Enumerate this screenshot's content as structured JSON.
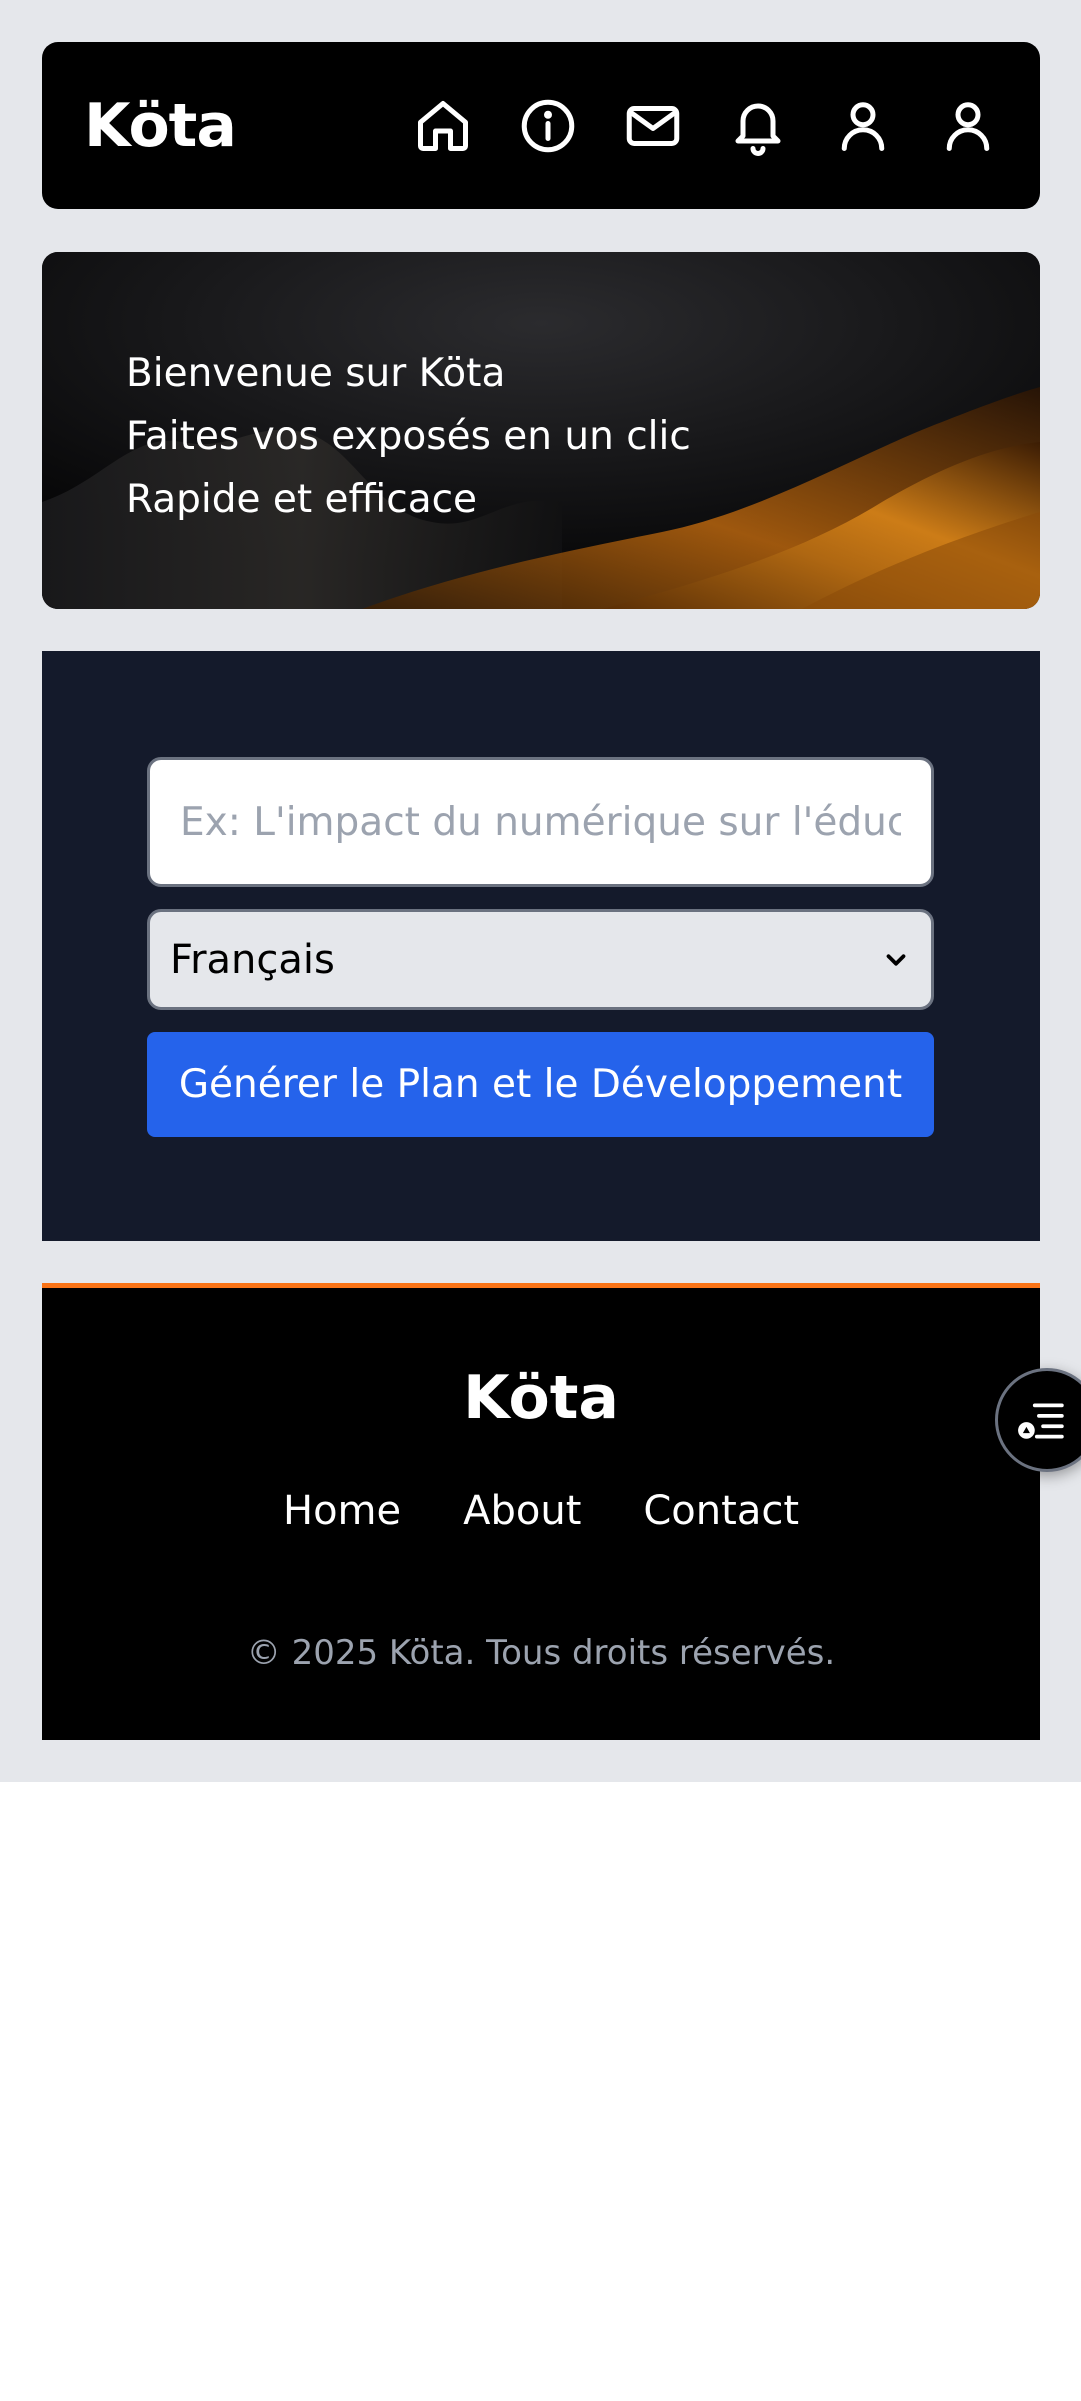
{
  "header": {
    "logo": "Köta",
    "icons": [
      "home-icon",
      "info-icon",
      "mail-icon",
      "bell-icon",
      "user-icon",
      "user-icon"
    ]
  },
  "hero": {
    "line1": "Bienvenue sur Köta",
    "line2": "Faites vos exposés en un clic",
    "line3": "Rapide et efficace"
  },
  "form": {
    "topic_placeholder": "Ex: L'impact du numérique sur l'éducation",
    "topic_value": "",
    "language_selected": "Français",
    "generate_label": "Générer le Plan et le Développement"
  },
  "footer": {
    "logo": "Köta",
    "links": [
      "Home",
      "About",
      "Contact"
    ],
    "copyright": "© 2025 Köta. Tous droits réservés."
  },
  "colors": {
    "header_bg": "#000000",
    "page_bg": "#e5e7eb",
    "panel_bg": "#141a2b",
    "button_bg": "#2563eb",
    "footer_accent": "#f97316"
  }
}
